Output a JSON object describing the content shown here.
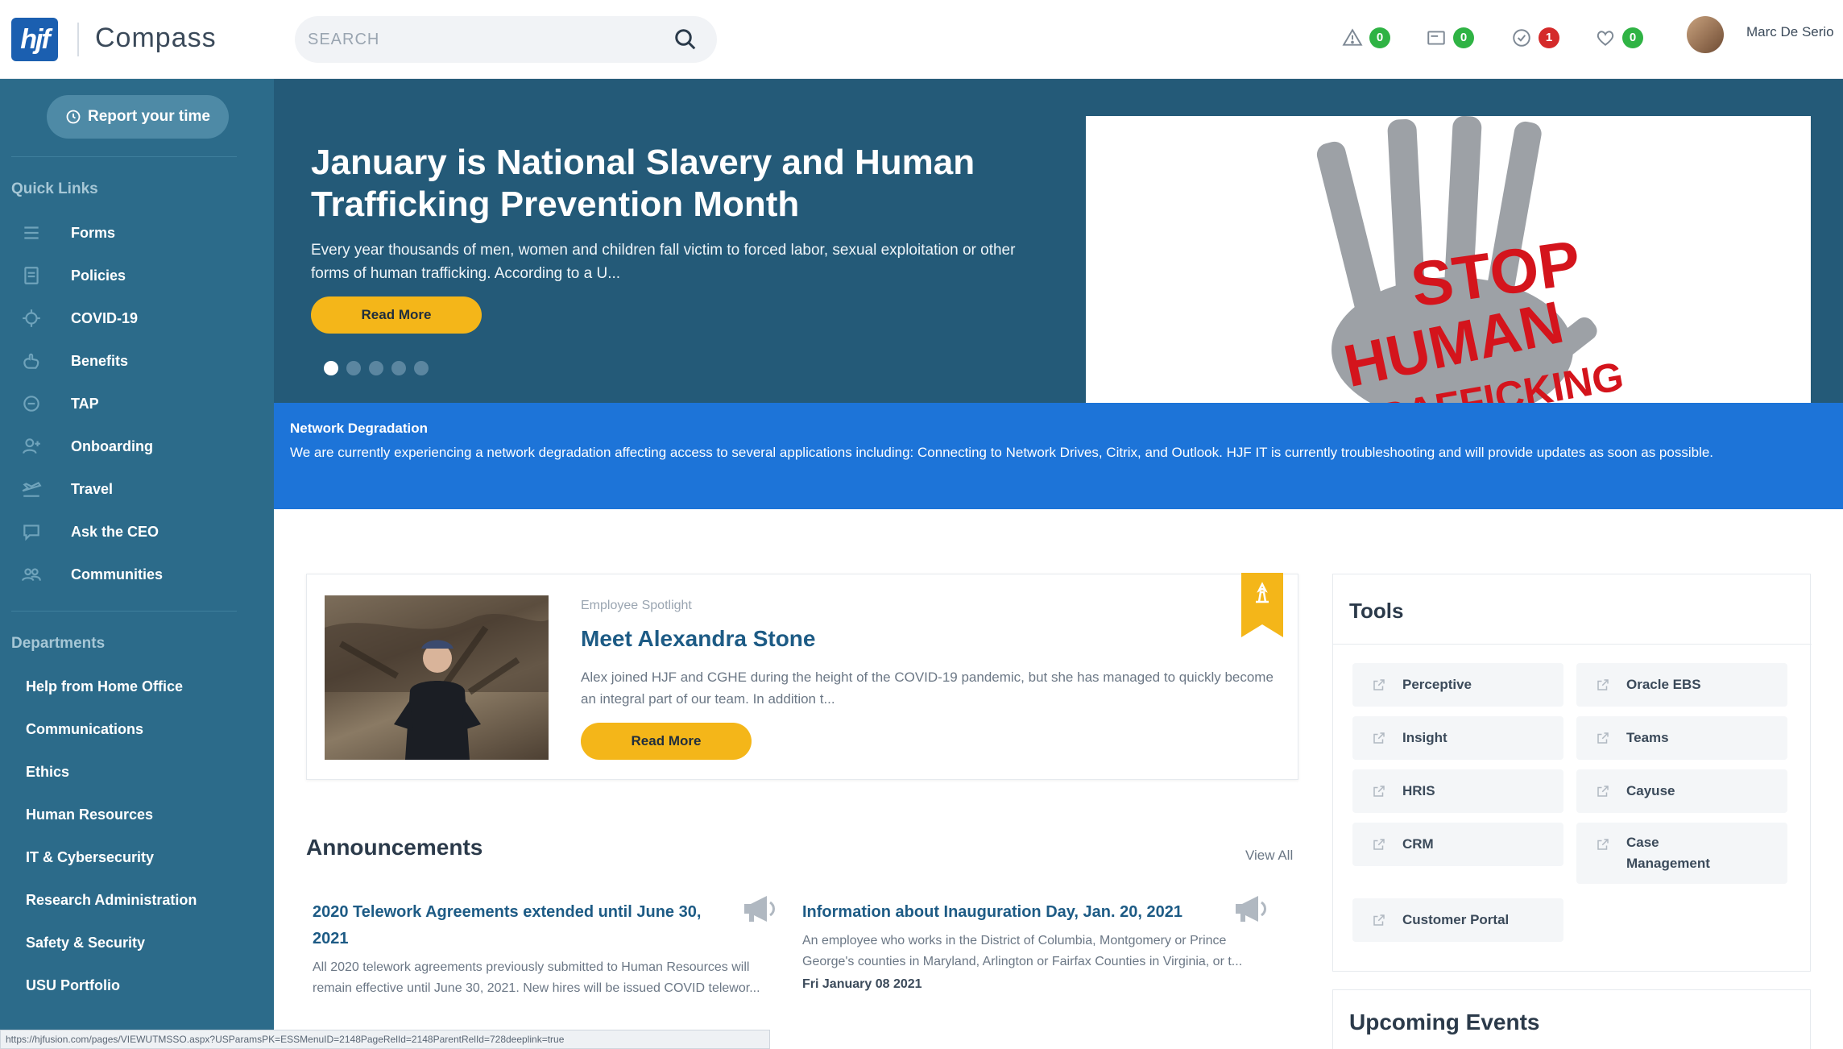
{
  "header": {
    "logo_text": "hjf",
    "app_name": "Compass",
    "search_placeholder": "SEARCH",
    "notifications": [
      {
        "icon": "alert-triangle-icon",
        "count": "0",
        "color": "#2fb344"
      },
      {
        "icon": "message-icon",
        "count": "0",
        "color": "#2fb344"
      },
      {
        "icon": "check-circle-icon",
        "count": "1",
        "color": "#d42a2a"
      },
      {
        "icon": "heart-icon",
        "count": "0",
        "color": "#2fb344"
      }
    ],
    "user_name": "Marc De Serio"
  },
  "sidebar": {
    "report_button": "Report your time",
    "quick_links_title": "Quick Links",
    "quick_links": [
      {
        "label": "Forms",
        "icon": "list-icon"
      },
      {
        "label": "Policies",
        "icon": "document-icon"
      },
      {
        "label": "COVID-19",
        "icon": "virus-icon"
      },
      {
        "label": "Benefits",
        "icon": "hand-icon"
      },
      {
        "label": "TAP",
        "icon": "circle-icon"
      },
      {
        "label": "Onboarding",
        "icon": "user-add-icon"
      },
      {
        "label": "Travel",
        "icon": "plane-icon"
      },
      {
        "label": "Ask the CEO",
        "icon": "chat-icon"
      },
      {
        "label": "Communities",
        "icon": "group-icon"
      }
    ],
    "departments_title": "Departments",
    "departments": [
      "Help from Home Office",
      "Communications",
      "Ethics",
      "Human Resources",
      "IT & Cybersecurity",
      "Research Administration",
      "Safety & Security",
      "USU Portfolio"
    ]
  },
  "hero": {
    "title": "January is National Slavery and Human Trafficking Prevention Month",
    "description": "Every year thousands of men, women and children fall victim to forced labor, sexual exploitation or other forms of human trafficking. According to a U...",
    "button": "Read More",
    "slide_count": 5,
    "active_slide": 1,
    "image_text": {
      "line1": "STOP",
      "line2": "HUMAN",
      "line3": "TRAFFICKING"
    }
  },
  "alert": {
    "title": "Network Degradation",
    "text": "We are currently experiencing a network degradation affecting access to several applications including: Connecting to Network Drives, Citrix, and Outlook. HJF IT is currently troubleshooting and will provide updates as soon as possible."
  },
  "spotlight": {
    "label": "Employee Spotlight",
    "title": "Meet Alexandra Stone",
    "description": "Alex joined HJF and CGHE during the height of the COVID-19 pandemic, but she has managed to quickly become an integral part of our team. In addition t...",
    "button": "Read More"
  },
  "announcements": {
    "title": "Announcements",
    "view_all": "View All",
    "items": [
      {
        "headline": "2020 Telework Agreements extended until June 30, 2021",
        "body": "All 2020 telework agreements previously submitted to Human Resources will remain effective until June 30, 2021. New hires will be issued COVID telewor...",
        "date": ""
      },
      {
        "headline": "Information about Inauguration Day, Jan. 20, 2021",
        "body": "An employee who works in the District of Columbia, Montgomery or Prince George's counties in Maryland, Arlington or Fairfax Counties in Virginia, or t...",
        "date": "Fri January 08 2021"
      }
    ]
  },
  "tools": {
    "title": "Tools",
    "items": [
      "Perceptive",
      "Oracle EBS",
      "Insight",
      "Teams",
      "HRIS",
      "Cayuse",
      "CRM",
      "Case Management",
      "Customer Portal"
    ]
  },
  "events": {
    "title": "Upcoming Events"
  },
  "status_bar": {
    "url": "https://hjfusion.com/pages/VIEWUTMSSO.aspx?USParamsPK=ESSMenuID=2148PageRelId=2148ParentRelId=728deeplink=true"
  }
}
